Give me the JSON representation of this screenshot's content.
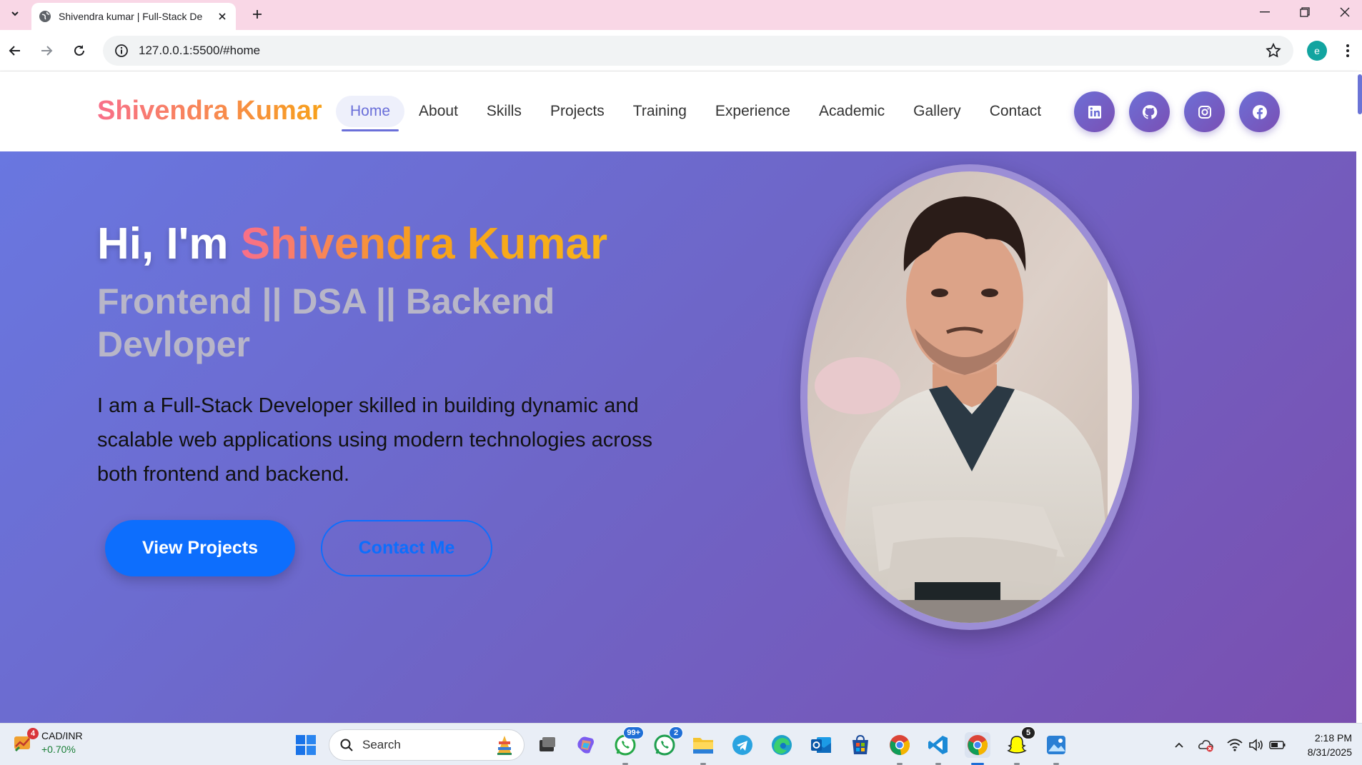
{
  "browser": {
    "tab_title": "Shivendra kumar | Full-Stack De",
    "url": "127.0.0.1:5500/#home",
    "profile_initial": "e"
  },
  "site": {
    "logo": "Shivendra Kumar",
    "nav": [
      {
        "label": "Home",
        "active": true
      },
      {
        "label": "About"
      },
      {
        "label": "Skills"
      },
      {
        "label": "Projects"
      },
      {
        "label": "Training"
      },
      {
        "label": "Experience"
      },
      {
        "label": "Academic"
      },
      {
        "label": "Gallery"
      },
      {
        "label": "Contact"
      }
    ],
    "social": [
      "linkedin-icon",
      "github-icon",
      "instagram-icon",
      "facebook-icon"
    ]
  },
  "hero": {
    "greeting": "Hi, I'm ",
    "name": "Shivendra Kumar",
    "role": "Frontend || DSA || Backend Devloper",
    "description": "I am a Full-Stack Developer skilled in building dynamic and scalable web applications using modern technologies across both frontend and backend.",
    "primary_button": "View Projects",
    "secondary_button": "Contact Me"
  },
  "taskbar": {
    "weather_badge": "4",
    "ticker_title": "CAD/INR",
    "ticker_value": "+0.70%",
    "search_label": "Search",
    "whatsapp_badge": "99+",
    "whatsapp2_badge": "2",
    "app_badge": "5",
    "time": "2:18 PM",
    "date": "8/31/2025"
  },
  "colors": {
    "accent": "#0d6efd",
    "logo_gradient_start": "#f86f8a",
    "logo_gradient_end": "#f7a11a",
    "hero_bg_start": "#6977e0",
    "hero_bg_end": "#7a4fb0"
  }
}
